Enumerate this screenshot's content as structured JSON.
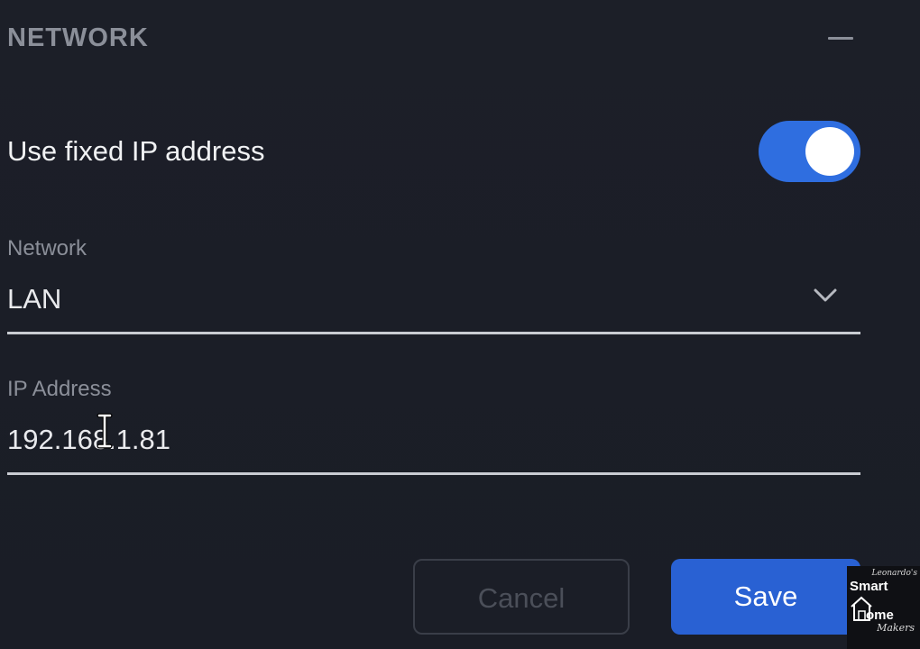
{
  "section": {
    "title": "NETWORK"
  },
  "fixed_ip": {
    "label": "Use fixed IP address",
    "enabled": true,
    "accent_color": "#2f6ee0"
  },
  "network_field": {
    "label": "Network",
    "value": "LAN"
  },
  "ip_field": {
    "label": "IP Address",
    "value": "192.168.1.81"
  },
  "buttons": {
    "cancel": "Cancel",
    "save": "Save"
  },
  "icons": {
    "collapse": "minus-icon",
    "dropdown": "chevron-down-icon",
    "cursor": "text-cursor-icon",
    "logo": "house-icon"
  },
  "watermark": {
    "top": "Leonardo's",
    "smart": "Smart",
    "home": "ome",
    "makers": "Makers"
  }
}
